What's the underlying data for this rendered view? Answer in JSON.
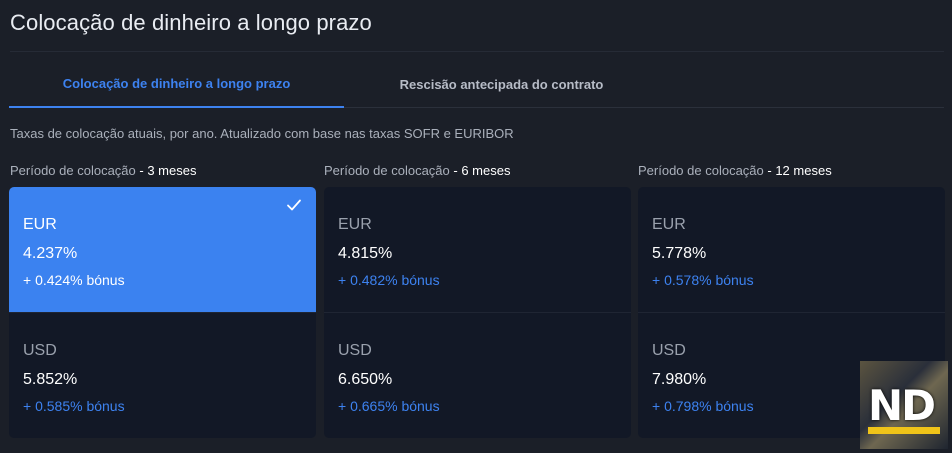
{
  "page": {
    "title": "Colocação de dinheiro a longo prazo"
  },
  "tabs": [
    {
      "label": "Colocação de dinheiro a longo prazo",
      "active": true
    },
    {
      "label": "Rescisão antecipada do contrato",
      "active": false
    }
  ],
  "subtitle": "Taxas de colocação atuais, por ano. Atualizado com base nas taxas SOFR e EURIBOR",
  "periods": [
    {
      "label": "Período de colocação",
      "value": "- 3 meses",
      "eur": {
        "currency": "EUR",
        "rate": "4.237%",
        "bonus": "+ 0.424% bónus",
        "selected": true
      },
      "usd": {
        "currency": "USD",
        "rate": "5.852%",
        "bonus": "+ 0.585% bónus"
      }
    },
    {
      "label": "Período de colocação",
      "value": "- 6 meses",
      "eur": {
        "currency": "EUR",
        "rate": "4.815%",
        "bonus": "+ 0.482% bónus"
      },
      "usd": {
        "currency": "USD",
        "rate": "6.650%",
        "bonus": "+ 0.665% bónus"
      }
    },
    {
      "label": "Período de colocação",
      "value": "- 12 meses",
      "eur": {
        "currency": "EUR",
        "rate": "5.778%",
        "bonus": "+ 0.578% bónus"
      },
      "usd": {
        "currency": "USD",
        "rate": "7.980%",
        "bonus": "+ 0.798% bónus"
      }
    }
  ],
  "icons": {
    "selected_check": "check-icon",
    "watermark": "nd-logo"
  },
  "colors": {
    "accent": "#3b82f0",
    "background": "#1b1f28",
    "card": "#121826"
  },
  "watermark": {
    "text": "ND"
  }
}
